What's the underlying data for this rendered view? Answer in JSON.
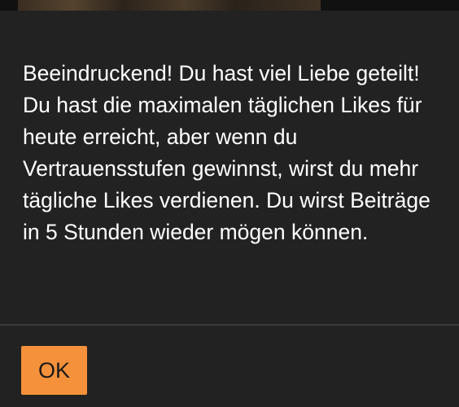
{
  "dialog": {
    "message": "Beeindruckend! Du hast viel Liebe geteilt! Du hast die maximalen täglichen Likes für heute erreicht, aber wenn du Vertrauensstufen gewinnst, wirst du mehr tägliche Likes verdienen. Du wirst Beiträge in 5 Stunden wieder mögen können.",
    "ok_label": "OK"
  },
  "colors": {
    "background": "#222222",
    "text": "#ffffff",
    "accent": "#f5913a",
    "divider": "#3b3b3b"
  }
}
